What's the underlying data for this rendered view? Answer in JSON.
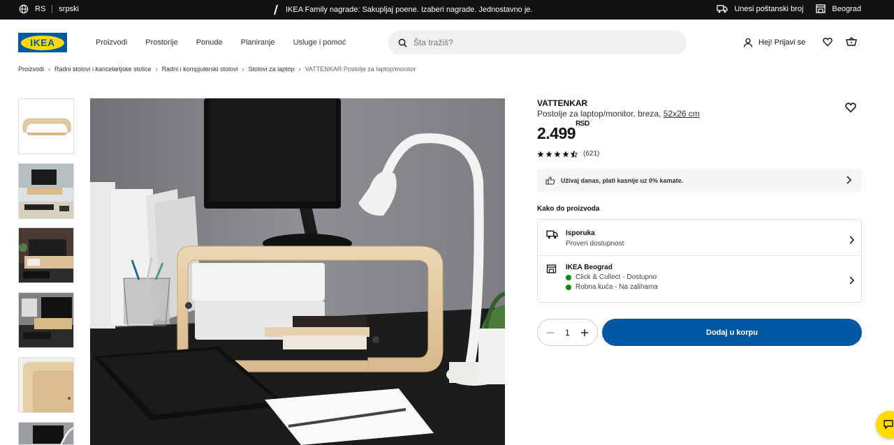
{
  "topbar": {
    "country": "RS",
    "language": "srpski",
    "promo": "IKEA Family nagrade: Sakupljaj poene. Izaberi nagrade. Jednostavno je.",
    "postal": "Unesi poštanski broj",
    "store": "Beograd"
  },
  "header": {
    "logo": "IKEA",
    "nav": [
      "Proizvodi",
      "Prostorije",
      "Ponude",
      "Planiranje",
      "Usluge i pomoć"
    ],
    "search_placeholder": "Šta tražiš?",
    "login": "Hej! Prijavi se"
  },
  "breadcrumb": [
    "Proizvodi",
    "Radni stolovi i kancelarijske stolice",
    "Radni i kompjuterski stolovi",
    "Stolovi za laptop",
    "VATTENKAR Postolje za laptop/monitor"
  ],
  "product": {
    "name": "VATTENKAR",
    "description": "Postolje za laptop/monitor, breza,",
    "size": "52x26 cm",
    "price": "2.499",
    "currency": "RSD",
    "rating": 4.5,
    "reviews": "(621)",
    "payment_note": "Uživaj danas, plati kasnije uz 0% kamate."
  },
  "availability": {
    "heading": "Kako do proizvoda",
    "delivery_title": "Isporuka",
    "delivery_sub": "Proveri dostupnost",
    "store_title": "IKEA Beograd",
    "store_lines": [
      "Click & Collect - Dostupno",
      "Robna kuća - Na zalihama"
    ],
    "status_color": "#0a8a00"
  },
  "cart": {
    "quantity": "1",
    "add_label": "Dodaj u korpu"
  },
  "colors": {
    "brand_blue": "#0058a3",
    "brand_yellow": "#ffdb00"
  }
}
